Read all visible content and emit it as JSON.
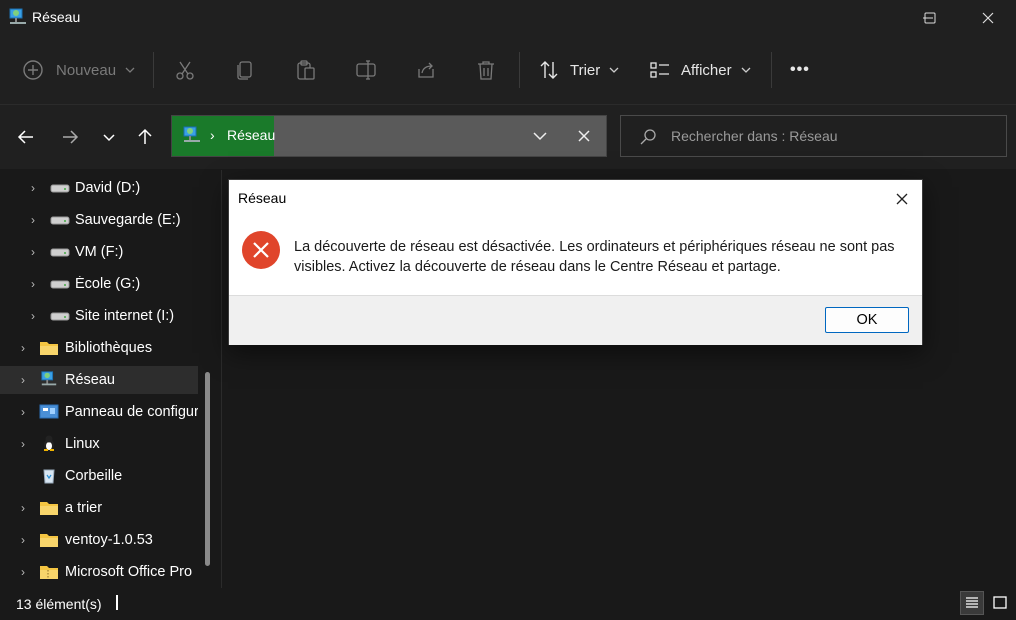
{
  "window": {
    "title": "Réseau",
    "controls": {
      "minimize": "—",
      "maximize": "☐",
      "close": "✕"
    }
  },
  "toolbar": {
    "new_label": "Nouveau",
    "sort_label": "Trier",
    "view_label": "Afficher",
    "more_label": "•••"
  },
  "navigation": {
    "address_segment": "Réseau",
    "search_placeholder": "Rechercher dans : Réseau"
  },
  "sidebar": {
    "items": [
      {
        "label": "David (D:)",
        "icon": "drive-icon",
        "expandable": true
      },
      {
        "label": "Sauvegarde (E:)",
        "icon": "drive-icon",
        "expandable": true
      },
      {
        "label": "VM (F:)",
        "icon": "drive-icon",
        "expandable": true
      },
      {
        "label": "École (G:)",
        "icon": "drive-icon",
        "expandable": true
      },
      {
        "label": "Site internet (I:)",
        "icon": "drive-icon",
        "expandable": true
      },
      {
        "label": "Bibliothèques",
        "icon": "folder-icon",
        "expandable": true
      },
      {
        "label": "Réseau",
        "icon": "network-icon",
        "expandable": true,
        "selected": true
      },
      {
        "label": "Panneau de configuration",
        "icon": "control-panel-icon",
        "expandable": true
      },
      {
        "label": "Linux",
        "icon": "linux-icon",
        "expandable": true
      },
      {
        "label": "Corbeille",
        "icon": "recycle-bin-icon",
        "expandable": false
      },
      {
        "label": "a trier",
        "icon": "folder-icon",
        "expandable": true
      },
      {
        "label": "ventoy-1.0.53",
        "icon": "folder-icon",
        "expandable": true
      },
      {
        "label": "Microsoft Office Pro",
        "icon": "folder-zip-icon",
        "expandable": true
      }
    ]
  },
  "status": {
    "item_count": "13 élément(s)"
  },
  "dialog": {
    "title": "Réseau",
    "message": "La découverte de réseau est désactivée. Les ordinateurs et périphériques réseau ne sont pas visibles. Activez la découverte de réseau dans le Centre Réseau et partage.",
    "ok_label": "OK"
  },
  "colors": {
    "accent": "#0067c0",
    "address_highlight": "#1a7a2a",
    "error": "#e0452b"
  }
}
